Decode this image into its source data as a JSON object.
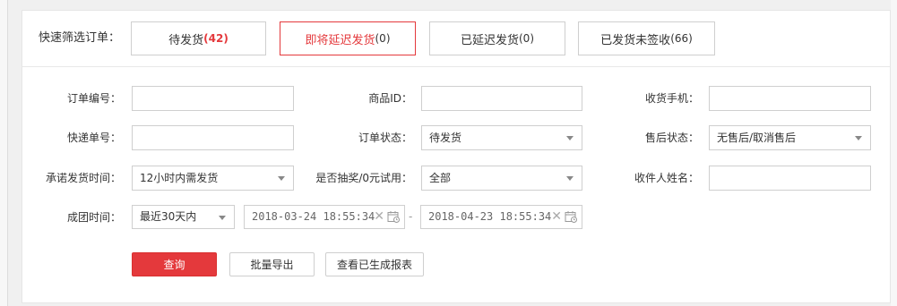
{
  "quick_filter": {
    "label": "快速筛选订单：",
    "buttons": [
      {
        "text": "待发货",
        "count": "(42)"
      },
      {
        "text": "即将延迟发货",
        "count": "(0)"
      },
      {
        "text": "已延迟发货",
        "count": "(0)"
      },
      {
        "text": "已发货未签收",
        "count": "(66)"
      }
    ]
  },
  "form": {
    "order_no": {
      "label": "订单编号：",
      "value": ""
    },
    "product_id": {
      "label": "商品ID：",
      "value": ""
    },
    "receiver_phone": {
      "label": "收货手机：",
      "value": ""
    },
    "tracking_no": {
      "label": "快递单号：",
      "value": ""
    },
    "order_status": {
      "label": "订单状态：",
      "value": "待发货"
    },
    "after_sale_status": {
      "label": "售后状态：",
      "value": "无售后/取消售后"
    },
    "promise_ship_time": {
      "label": "承诺发货时间：",
      "value": "12小时内需发货"
    },
    "lottery_trial": {
      "label": "是否抽奖/0元试用：",
      "value": "全部"
    },
    "receiver_name": {
      "label": "收件人姓名：",
      "value": ""
    },
    "group_time": {
      "label": "成团时间：",
      "range": "最近30天内",
      "start": "2018-03-24 18:55:34",
      "separator": "-",
      "end": "2018-04-23 18:55:34"
    }
  },
  "actions": {
    "query": "查询",
    "batch_export": "批量导出",
    "view_reports": "查看已生成报表"
  },
  "colors": {
    "accent": "#e4393c",
    "border": "#cfcfcf"
  }
}
